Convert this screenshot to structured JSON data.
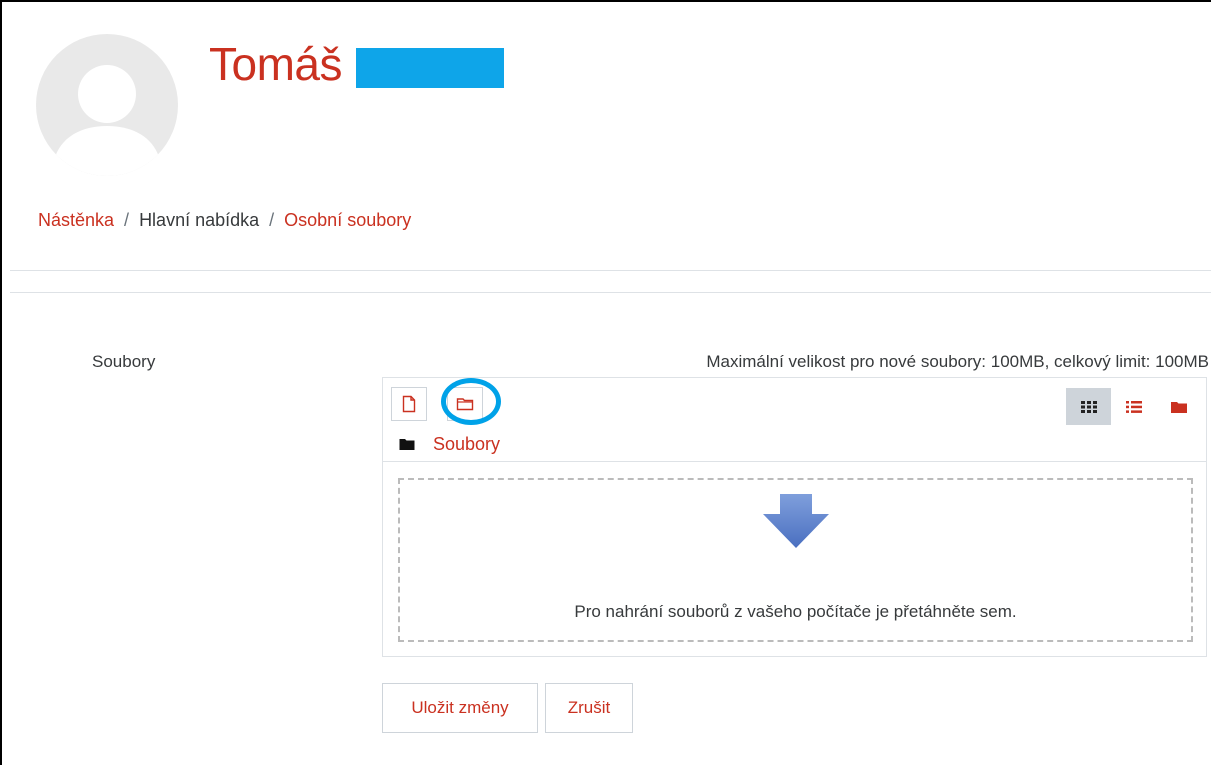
{
  "profile": {
    "first_name": "Tomáš",
    "redaction_color": "#0ea5e9"
  },
  "breadcrumb": {
    "items": [
      {
        "label": "Nástěnka",
        "link": true
      },
      {
        "label": "Hlavní nabídka",
        "link": false
      },
      {
        "label": "Osobní soubory",
        "link": true
      }
    ],
    "separator": "/"
  },
  "files_form": {
    "field_label": "Soubory",
    "max_size_text": "Maximální velikost pro nové soubory: 100MB, celkový limit: 100MB",
    "toolbar": {
      "add_file_icon": "file-icon",
      "create_folder_icon": "folder-icon",
      "highlight_color": "#00a2e8",
      "views": [
        {
          "icon": "grid-icon",
          "active": true
        },
        {
          "icon": "list-icon",
          "active": false
        },
        {
          "icon": "folder-tree-icon",
          "active": false
        }
      ]
    },
    "path": {
      "folder_label": "Soubory"
    },
    "dropzone": {
      "message": "Pro nahrání souborů z vašeho počítače je přetáhněte sem."
    }
  },
  "buttons": {
    "save_label": "Uložit změny",
    "cancel_label": "Zrušit"
  },
  "colors": {
    "accent": "#ca3120",
    "text": "#373a3c"
  }
}
